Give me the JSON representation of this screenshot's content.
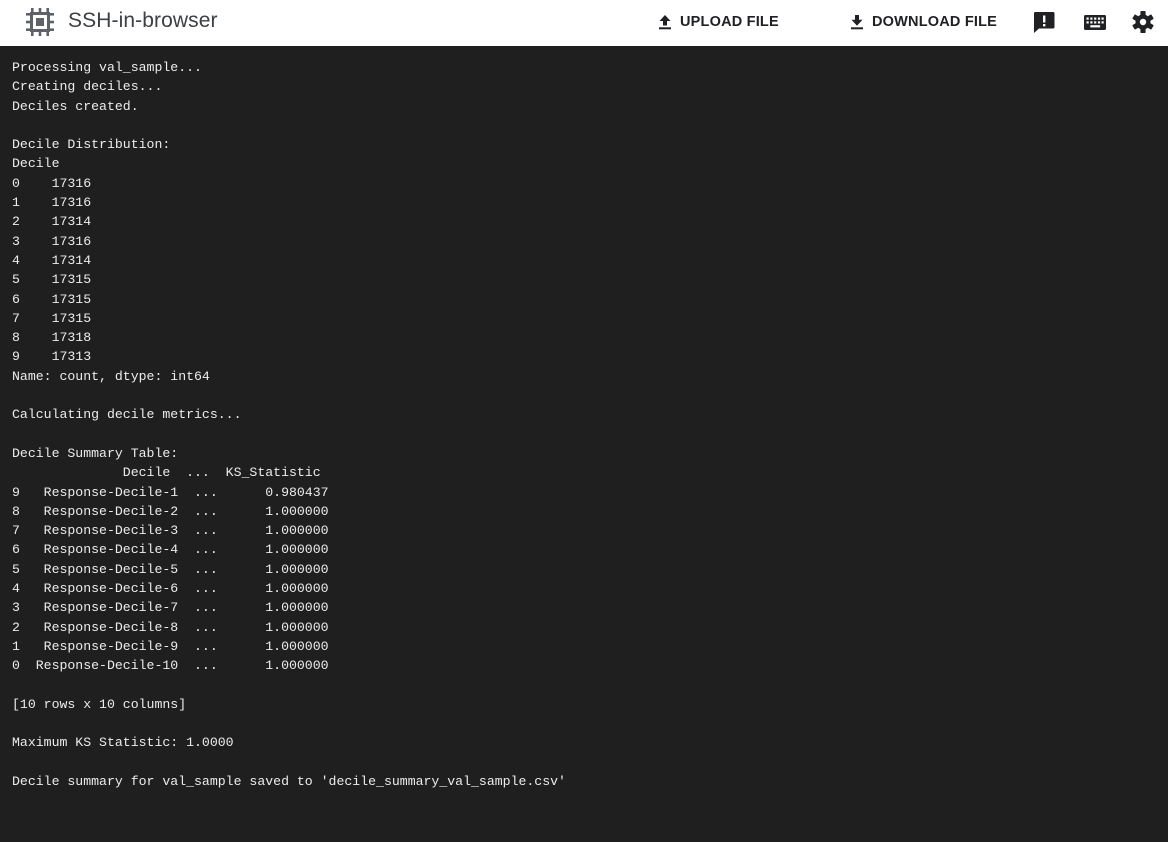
{
  "app": {
    "title": "SSH-in-browser",
    "icon": "chip-icon"
  },
  "toolbar": {
    "upload_label": "UPLOAD FILE",
    "download_label": "DOWNLOAD FILE",
    "upload_icon": "upload-arrow-icon",
    "download_icon": "download-arrow-icon",
    "feedback_icon": "feedback-icon",
    "keyboard_icon": "keyboard-icon",
    "settings_icon": "gear-icon"
  },
  "colors": {
    "terminal_bg": "#1f1f1f",
    "terminal_fg": "#ececec",
    "toolbar_text": "#202124"
  },
  "terminal": {
    "lines": [
      "Processing val_sample...",
      "Creating deciles...",
      "Deciles created.",
      "",
      "Decile Distribution:",
      "Decile",
      "0    17316",
      "1    17316",
      "2    17314",
      "3    17316",
      "4    17314",
      "5    17315",
      "6    17315",
      "7    17315",
      "8    17318",
      "9    17313",
      "Name: count, dtype: int64",
      "",
      "Calculating decile metrics...",
      "",
      "Decile Summary Table:",
      "              Decile  ...  KS_Statistic",
      "9   Response-Decile-1  ...      0.980437",
      "8   Response-Decile-2  ...      1.000000",
      "7   Response-Decile-3  ...      1.000000",
      "6   Response-Decile-4  ...      1.000000",
      "5   Response-Decile-5  ...      1.000000",
      "4   Response-Decile-6  ...      1.000000",
      "3   Response-Decile-7  ...      1.000000",
      "2   Response-Decile-8  ...      1.000000",
      "1   Response-Decile-9  ...      1.000000",
      "0  Response-Decile-10  ...      1.000000",
      "",
      "[10 rows x 10 columns]",
      "",
      "Maximum KS Statistic: 1.0000",
      "",
      "Decile summary for val_sample saved to 'decile_summary_val_sample.csv'"
    ]
  }
}
